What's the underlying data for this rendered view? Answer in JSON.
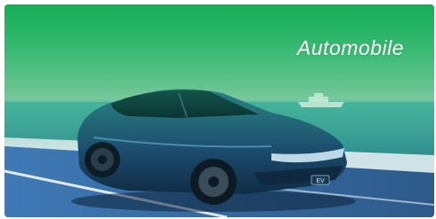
{
  "card": {
    "title": "Automobile",
    "badge_text": "EV"
  },
  "colors": {
    "overlay_green": "#1bb35a",
    "sea": "#4fb3b2",
    "car_body": "#1f4a6e",
    "road": "#3b6ea8"
  }
}
